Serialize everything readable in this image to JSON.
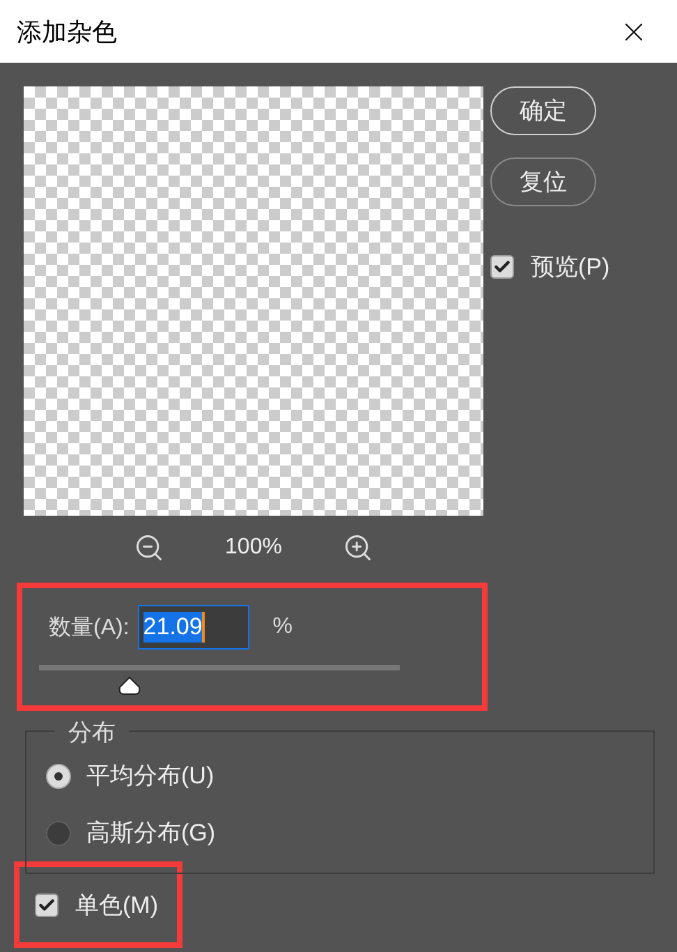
{
  "window": {
    "title": "添加杂色"
  },
  "buttons": [
    {
      "label": "确定",
      "default": true
    },
    {
      "label": "复位",
      "default": false
    }
  ],
  "preview_checkbox": {
    "label": "预览(P)",
    "checked": true
  },
  "zoom": {
    "reading": "100%"
  },
  "amount": {
    "label": "数量(A):",
    "value": "21.09",
    "value_selected": true,
    "unit": "%",
    "level": 0.25
  },
  "distribution": {
    "title": "分布",
    "options": [
      {
        "label": "平均分布(U)",
        "selected": true
      },
      {
        "label": "高斯分布(G)",
        "selected": false
      }
    ]
  },
  "monochromatic": {
    "label": "单色(M)",
    "checked": true
  }
}
